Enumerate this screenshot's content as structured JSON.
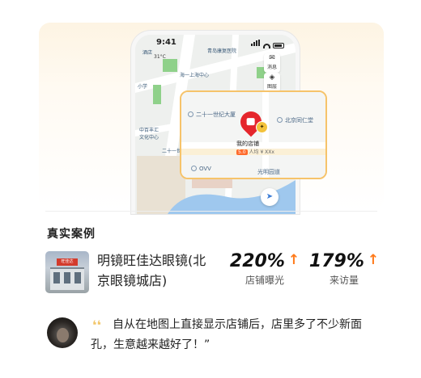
{
  "phone": {
    "time": "9:41",
    "temperature": "31°C",
    "side_buttons": [
      {
        "label": "消息",
        "icon": "mail-icon"
      },
      {
        "label": "图层",
        "icon": "layers-icon"
      }
    ],
    "map_labels": [
      "青岛康复医院",
      "酒店",
      "海一上海中心",
      "小学",
      "中百丰汇",
      "文化中心",
      "二十一世纪"
    ]
  },
  "card": {
    "pois": [
      "二十一世纪大厦",
      "北京同仁堂",
      "OVV",
      "光明园道"
    ],
    "store_name": "我的店铺",
    "store_badge": "5.0",
    "store_meta": "人均 ¥ XXx"
  },
  "section_title": "真实案例",
  "case": {
    "name": "明镜旺佳达眼镜(北京眼镜城店)",
    "shop_sign": "旺佳达",
    "stats": [
      {
        "value": "220%",
        "label": "店铺曝光",
        "arrow": "↑"
      },
      {
        "value": "179%",
        "label": "来访量",
        "arrow": "↑"
      }
    ]
  },
  "testimonial": {
    "quote_mark": "❛❛",
    "text": "自从在地图上直接显示店铺后，店里多了不少新面孔，生意越来越好了！”"
  },
  "colors": {
    "accent": "#ff7a1a",
    "pin": "#e5262c",
    "card_border": "#f6c36a"
  }
}
